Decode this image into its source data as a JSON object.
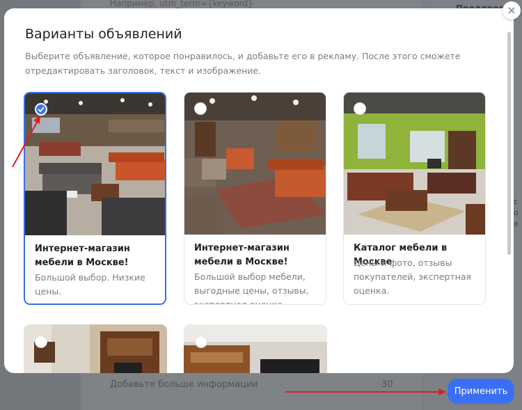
{
  "background": {
    "input_hint": "Например, utm_term={keyword}",
    "preview_tab": "Предпросм",
    "more_info_label": "Добавьте больше информации",
    "more_info_count": "30",
    "right_edge_text": "с\nо\nе"
  },
  "modal": {
    "title": "Варианты объявлений",
    "subtitle": "Выберите объявление, которое понравилось, и добавьте его в рекламу. После этого сможете отредактировать заголовок, текст и изображение.",
    "close_icon": "close-icon"
  },
  "cards": [
    {
      "title": "Интернет-магазин мебели в Москве!",
      "text": "Большой выбор. Низкие цены.",
      "selected": true
    },
    {
      "title": "Интернет-магазин мебели в Москве!",
      "text": "Большой выбор мебели, выгодные цены, отзывы, экспертная оценка.",
      "selected": false
    },
    {
      "title": "Каталог мебели в Москве",
      "text": "Цены и фото, отзывы покупателей, экспертная оценка.",
      "selected": false
    }
  ],
  "apply_button": {
    "label": "Применить"
  },
  "colors": {
    "accent": "#3b6ff3",
    "annotation": "#e01e1e"
  }
}
